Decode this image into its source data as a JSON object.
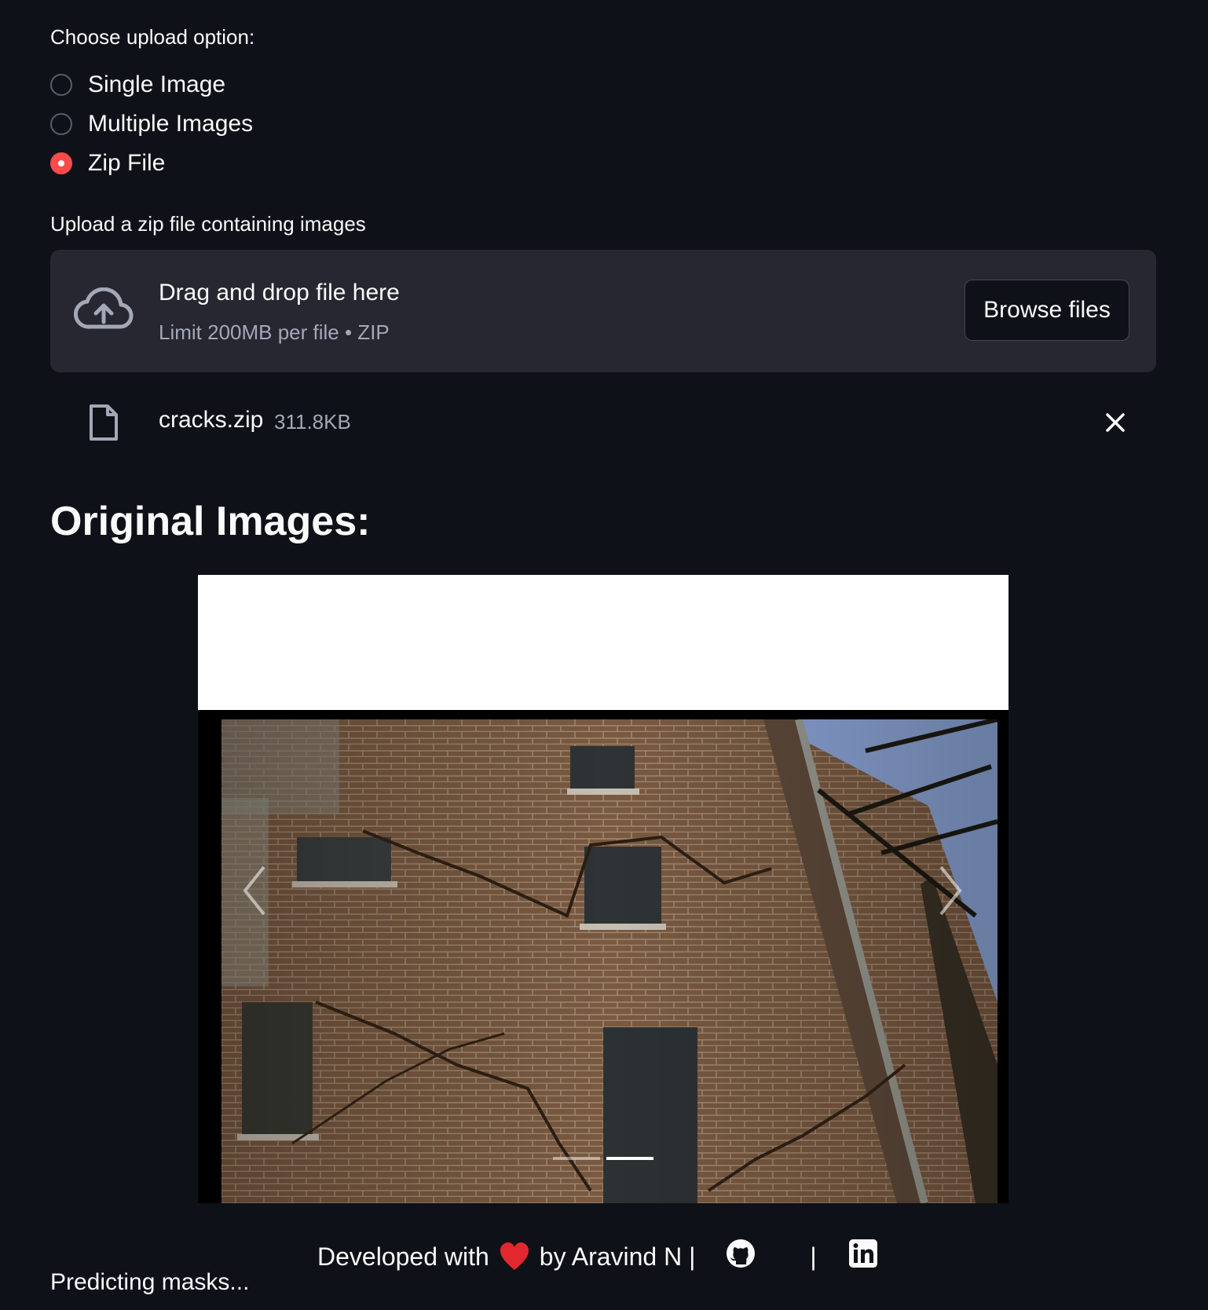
{
  "upload_option": {
    "label": "Choose upload option:",
    "options": [
      {
        "label": "Single Image",
        "selected": false
      },
      {
        "label": "Multiple Images",
        "selected": false
      },
      {
        "label": "Zip File",
        "selected": true
      }
    ]
  },
  "uploader": {
    "label": "Upload a zip file containing images",
    "drag_text": "Drag and drop file here",
    "limit_text": "Limit 200MB per file • ZIP",
    "browse_label": "Browse files"
  },
  "uploaded_file": {
    "name": "cracks.zip",
    "size": "311.8KB"
  },
  "heading": "Original Images:",
  "carousel": {
    "slide_count": 2,
    "active_slide": 2
  },
  "footer": {
    "prefix": "Developed with",
    "suffix": "by Aravind N |",
    "separator": "|",
    "icons": [
      "heart-icon",
      "github-icon",
      "linkedin-icon"
    ]
  },
  "status": "Predicting masks...",
  "colors": {
    "background": "#0e1117",
    "accent": "#ff4b4b",
    "panel": "#262730"
  }
}
